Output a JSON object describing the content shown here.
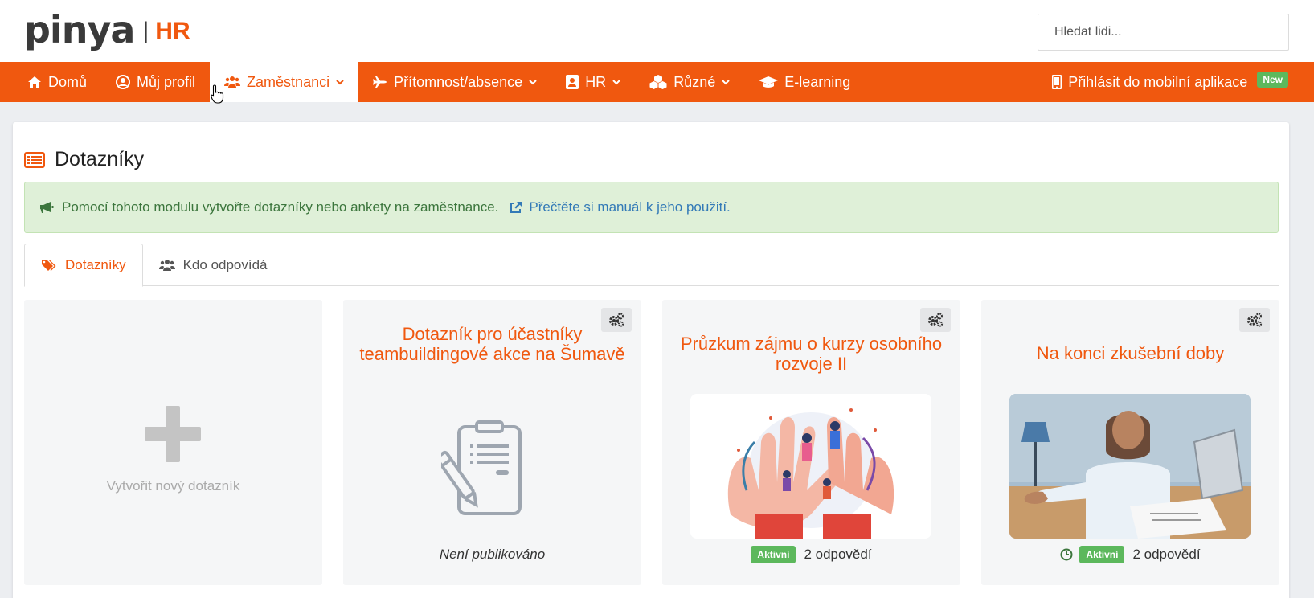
{
  "header": {
    "logo_word": "pinya",
    "logo_separator": "|",
    "logo_suffix": "HR",
    "search_placeholder": "Hledat lidi...",
    "brand_color": "#f0580f"
  },
  "nav": {
    "items": [
      {
        "label": "Domů",
        "icon": "home-icon"
      },
      {
        "label": "Můj profil",
        "icon": "user-circle-icon"
      },
      {
        "label": "Zaměstnanci",
        "icon": "users-icon",
        "dropdown": true,
        "active": true
      },
      {
        "label": "Přítomnost/absence",
        "icon": "plane-icon",
        "dropdown": true
      },
      {
        "label": "HR",
        "icon": "id-card-icon",
        "dropdown": true
      },
      {
        "label": "Různé",
        "icon": "cubes-icon",
        "dropdown": true
      },
      {
        "label": "E-learning",
        "icon": "graduation-cap-icon"
      }
    ],
    "mobile_label": "Přihlásit do mobilní aplikace",
    "mobile_badge": "New"
  },
  "page": {
    "title": "Dotazníky",
    "alert_text": "Pomocí tohoto modulu vytvořte dotazníky nebo ankety na zaměstnance.",
    "alert_link": "Přečtěte si manuál k jeho použití.",
    "tabs": [
      {
        "label": "Dotazníky",
        "icon": "tags-icon",
        "active": true
      },
      {
        "label": "Kdo odpovídá",
        "icon": "users-icon"
      }
    ]
  },
  "cards": {
    "new_card_label": "Vytvořit nový dotazník",
    "items": [
      {
        "title": "Dotazník pro účastníky teambuildingové akce na Šumavě",
        "status": "Není publikováno",
        "image": "clipboard-icon"
      },
      {
        "title": "Průzkum zájmu o kurzy osobního rozvoje II",
        "badge": "Aktivní",
        "responses": "2 odpovědí",
        "image": "hands-illustration"
      },
      {
        "title": "Na konci zkušební doby",
        "badge": "Aktivní",
        "responses": "2 odpovědí",
        "image": "handshake-photo",
        "clock": true
      }
    ]
  }
}
